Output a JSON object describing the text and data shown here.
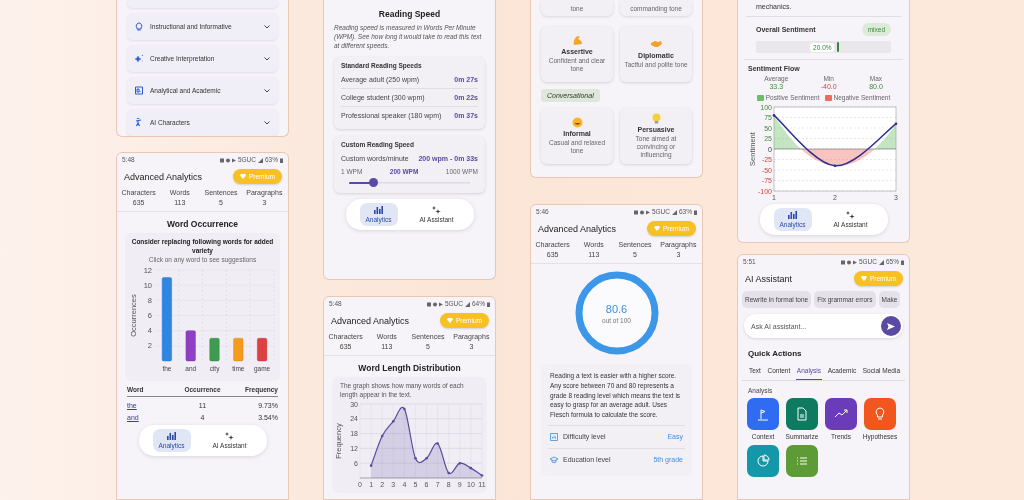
{
  "style_categories": {
    "items": [
      {
        "label": "Instructional and Informative"
      },
      {
        "label": "Creative Interpretation"
      },
      {
        "label": "Analytical and Academic"
      },
      {
        "label": "AI Characters"
      }
    ]
  },
  "word_occurrence_screen": {
    "status": {
      "time": "5:48",
      "network": "5GUC",
      "battery": "63%"
    },
    "title": "Advanced Analytics",
    "premium": "Premium",
    "stats": [
      {
        "label": "Characters",
        "value": "635"
      },
      {
        "label": "Words",
        "value": "113"
      },
      {
        "label": "Sentences",
        "value": "5"
      },
      {
        "label": "Paragraphs",
        "value": "3"
      }
    ],
    "heading": "Word Occurrence",
    "card_title": "Consider replacing following words for added variety",
    "hint": "Click on any word to see suggestions",
    "chart_data": {
      "type": "bar",
      "ylabel": "Occurrences",
      "categories": [
        "the",
        "and",
        "city",
        "time",
        "game"
      ],
      "values": [
        11,
        4,
        3,
        3,
        3
      ],
      "ylim": [
        0,
        12
      ],
      "yticks": [
        2,
        4,
        6,
        8,
        10,
        12
      ],
      "grid": true
    },
    "table": {
      "columns": [
        "Word",
        "Occurrence",
        "Frequency"
      ],
      "rows": [
        {
          "word": "the",
          "count": "11",
          "frequency": "9.73%"
        },
        {
          "word": "and",
          "count": "4",
          "frequency": "3.54%"
        }
      ]
    },
    "nav": [
      {
        "label": "Analytics",
        "selected": true
      },
      {
        "label": "AI Assistant",
        "selected": false
      }
    ]
  },
  "reading_speed_screen": {
    "title": "Reading Speed",
    "description": "Reading speed is measured in Words Per Minute (WPM). See how long it would take to read this text at different speeds.",
    "standard": {
      "title": "Standard Reading Speeds",
      "rows": [
        {
          "label": "Average adult (250 wpm)",
          "time": "0m 27s"
        },
        {
          "label": "College student (300 wpm)",
          "time": "0m 22s"
        },
        {
          "label": "Professional speaker (180 wpm)",
          "time": "0m 37s"
        }
      ]
    },
    "custom": {
      "title": "Custom Reading Speed",
      "label": "Custom words/minute",
      "value": "200 wpm - 0m 33s",
      "min_label": "1 WPM",
      "current_label": "200 WPM",
      "max_label": "1000 WPM",
      "level": 0.2
    },
    "nav": [
      {
        "label": "Analytics",
        "selected": true
      },
      {
        "label": "AI Assistant",
        "selected": false
      }
    ]
  },
  "word_length_screen": {
    "status": {
      "time": "5:48",
      "network": "5GUC",
      "battery": "64%"
    },
    "title": "Advanced Analytics",
    "premium": "Premium",
    "stats": [
      {
        "label": "Characters",
        "value": "635"
      },
      {
        "label": "Words",
        "value": "113"
      },
      {
        "label": "Sentences",
        "value": "5"
      },
      {
        "label": "Paragraphs",
        "value": "3"
      }
    ],
    "heading": "Word Length Distribution",
    "description": "The graph shows how many words of each length appear in the text.",
    "chart_data": {
      "type": "area",
      "ylabel": "Frequency",
      "x": [
        1,
        2,
        3,
        4,
        5,
        6,
        7,
        8,
        9,
        10,
        11
      ],
      "series": [
        {
          "color": "#5a4a9c",
          "values": [
            5,
            17,
            23,
            28,
            8,
            8,
            14,
            2,
            6,
            4,
            1
          ]
        }
      ],
      "xlim": [
        0,
        11
      ],
      "ylim": [
        0,
        30
      ],
      "xticks": [
        0,
        1,
        2,
        3,
        4,
        5,
        6,
        7,
        8,
        9,
        10,
        11
      ],
      "yticks": [
        6,
        12,
        18,
        24,
        30
      ],
      "grid": true
    }
  },
  "tone_screen": {
    "partial_cards": [
      {
        "description": "tone"
      },
      {
        "description": "commanding tone"
      }
    ],
    "cards": [
      {
        "name": "Assertive",
        "description": "Confident and clear tone"
      },
      {
        "name": "Diplomatic",
        "description": "Tactful and polite tone"
      }
    ],
    "section": "Conversational",
    "section_cards": [
      {
        "name": "Informal",
        "description": "Casual and relaxed tone"
      },
      {
        "name": "Persuasive",
        "description": "Tone aimed at convincing or influencing"
      }
    ]
  },
  "readability_screen": {
    "status": {
      "time": "5:46",
      "network": "5GUC",
      "battery": "63%"
    },
    "title": "Advanced Analytics",
    "premium": "Premium",
    "stats": [
      {
        "label": "Characters",
        "value": "635"
      },
      {
        "label": "Words",
        "value": "113"
      },
      {
        "label": "Sentences",
        "value": "5"
      },
      {
        "label": "Paragraphs",
        "value": "3"
      }
    ],
    "score": "80.6",
    "score_caption": "out of 100",
    "description": "Reading a text is easier with a higher score. Any score between 70 and 80 represents a grade 8 reading level which means the text is easy to grasp for an average adult. Uses Flesch formula to calculate the score.",
    "details": [
      {
        "label": "Difficulty level",
        "value": "Easy"
      },
      {
        "label": "Education level",
        "value": "5th grade"
      }
    ]
  },
  "sentiment_screen": {
    "summary_tail": "mechanics.",
    "overall_label": "Overall Sentiment",
    "overall_badge": "mixed",
    "bar_label": "20.0%",
    "level": 0.6,
    "flow_title": "Sentiment Flow",
    "flow_stats": [
      {
        "label": "Average",
        "value": "33.3",
        "kind": "neutral"
      },
      {
        "label": "Min",
        "value": "-40.0",
        "kind": "negative"
      },
      {
        "label": "Max",
        "value": "80.0",
        "kind": "positive"
      }
    ],
    "legend": [
      {
        "label": "Positive Sentiment",
        "color": "#6cbf63"
      },
      {
        "label": "Negative Sentiment",
        "color": "#ef6b5e"
      }
    ],
    "chart_data": {
      "type": "line",
      "ylabel": "Sentiment",
      "x": [
        1,
        2,
        3
      ],
      "series": [
        {
          "color": "#2c2f8f",
          "values": [
            80,
            -40,
            60
          ]
        }
      ],
      "xlim": [
        1,
        3
      ],
      "ylim": [
        -100,
        100
      ],
      "xticks": [
        1,
        2,
        3
      ],
      "yticks": [
        -100,
        -75,
        -50,
        -25,
        0,
        25,
        50,
        75,
        100
      ],
      "grid": true
    },
    "nav": [
      {
        "label": "Analytics",
        "selected": true
      },
      {
        "label": "AI Assistant",
        "selected": false
      }
    ]
  },
  "ai_assistant_screen": {
    "status": {
      "time": "5:51",
      "network": "5GUC",
      "battery": "65%"
    },
    "title": "AI Assistant",
    "premium": "Premium",
    "suggestions": [
      "Rewrite in formal tone",
      "Fix grammar errors",
      "Make"
    ],
    "input": {
      "placeholder": "Ask AI assistant..."
    },
    "quick_actions_title": "Quick Actions",
    "tabs": [
      {
        "label": "Text",
        "selected": false
      },
      {
        "label": "Content",
        "selected": false
      },
      {
        "label": "Analysis",
        "selected": true
      },
      {
        "label": "Academic",
        "selected": false
      },
      {
        "label": "Social Media",
        "selected": false
      }
    ],
    "section_label": "Analysis",
    "actions": [
      {
        "label": "Context",
        "color": "#2f6cf2"
      },
      {
        "label": "Summarize",
        "color": "#0e7a60"
      },
      {
        "label": "Trends",
        "color": "#6b3cb9"
      },
      {
        "label": "Hypotheses",
        "color": "#f2561f"
      },
      {
        "color": "#1597aa"
      },
      {
        "color": "#5c9b36"
      }
    ]
  }
}
